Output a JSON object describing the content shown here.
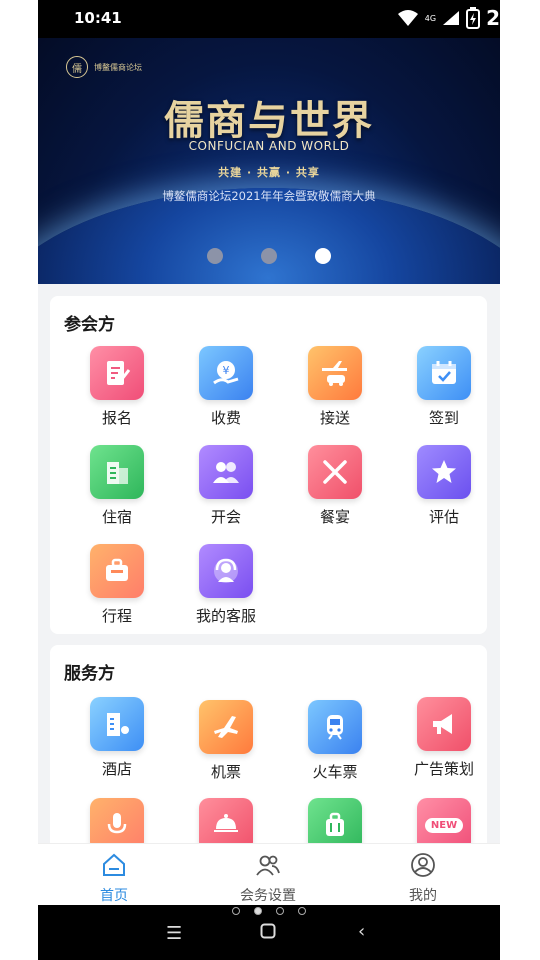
{
  "status_bar": {
    "time": "10:41",
    "network": "4G",
    "battery_text": "2"
  },
  "banner": {
    "logo_text": "博鳌儒商论坛",
    "title": "儒商与世界",
    "subtitle": "CONFUCIAN    AND WORLD",
    "slogan": "共建 · 共赢 · 共享",
    "caption": "博鳌儒商论坛2021年年会暨致敬儒商大典",
    "slide_count": 3,
    "active_slide": 3
  },
  "attendee_section": {
    "title": "参会方",
    "items": [
      {
        "label": "报名",
        "icon": "edit-form-icon"
      },
      {
        "label": "收费",
        "icon": "yen-coin-icon"
      },
      {
        "label": "接送",
        "icon": "plane-car-icon"
      },
      {
        "label": "签到",
        "icon": "calendar-check-icon"
      },
      {
        "label": "住宿",
        "icon": "building-icon"
      },
      {
        "label": "开会",
        "icon": "people-group-icon"
      },
      {
        "label": "餐宴",
        "icon": "fork-knife-icon"
      },
      {
        "label": "评估",
        "icon": "star-icon"
      },
      {
        "label": "行程",
        "icon": "suitcase-icon"
      },
      {
        "label": "我的客服",
        "icon": "headset-icon"
      }
    ]
  },
  "service_section": {
    "title": "服务方",
    "items": [
      {
        "label": "酒店",
        "icon": "hotel-icon"
      },
      {
        "label": "机票",
        "icon": "airplane-icon"
      },
      {
        "label": "火车票",
        "icon": "train-icon"
      },
      {
        "label": "广告策划",
        "icon": "megaphone-icon"
      },
      {
        "label": "",
        "icon": "microphone-icon"
      },
      {
        "label": "",
        "icon": "dining-cloche-icon"
      },
      {
        "label": "",
        "icon": "luggage-icon"
      },
      {
        "label": "",
        "icon": "new-badge-icon",
        "badge": "NEW"
      }
    ]
  },
  "tab_bar": {
    "tabs": [
      {
        "label": "首页",
        "icon": "home-icon",
        "active": true
      },
      {
        "label": "会务设置",
        "icon": "users-icon",
        "active": false
      },
      {
        "label": "我的",
        "icon": "profile-icon",
        "active": false
      }
    ]
  },
  "colors": {
    "accent": "#2c8be0",
    "background": "#f2f3f5"
  }
}
